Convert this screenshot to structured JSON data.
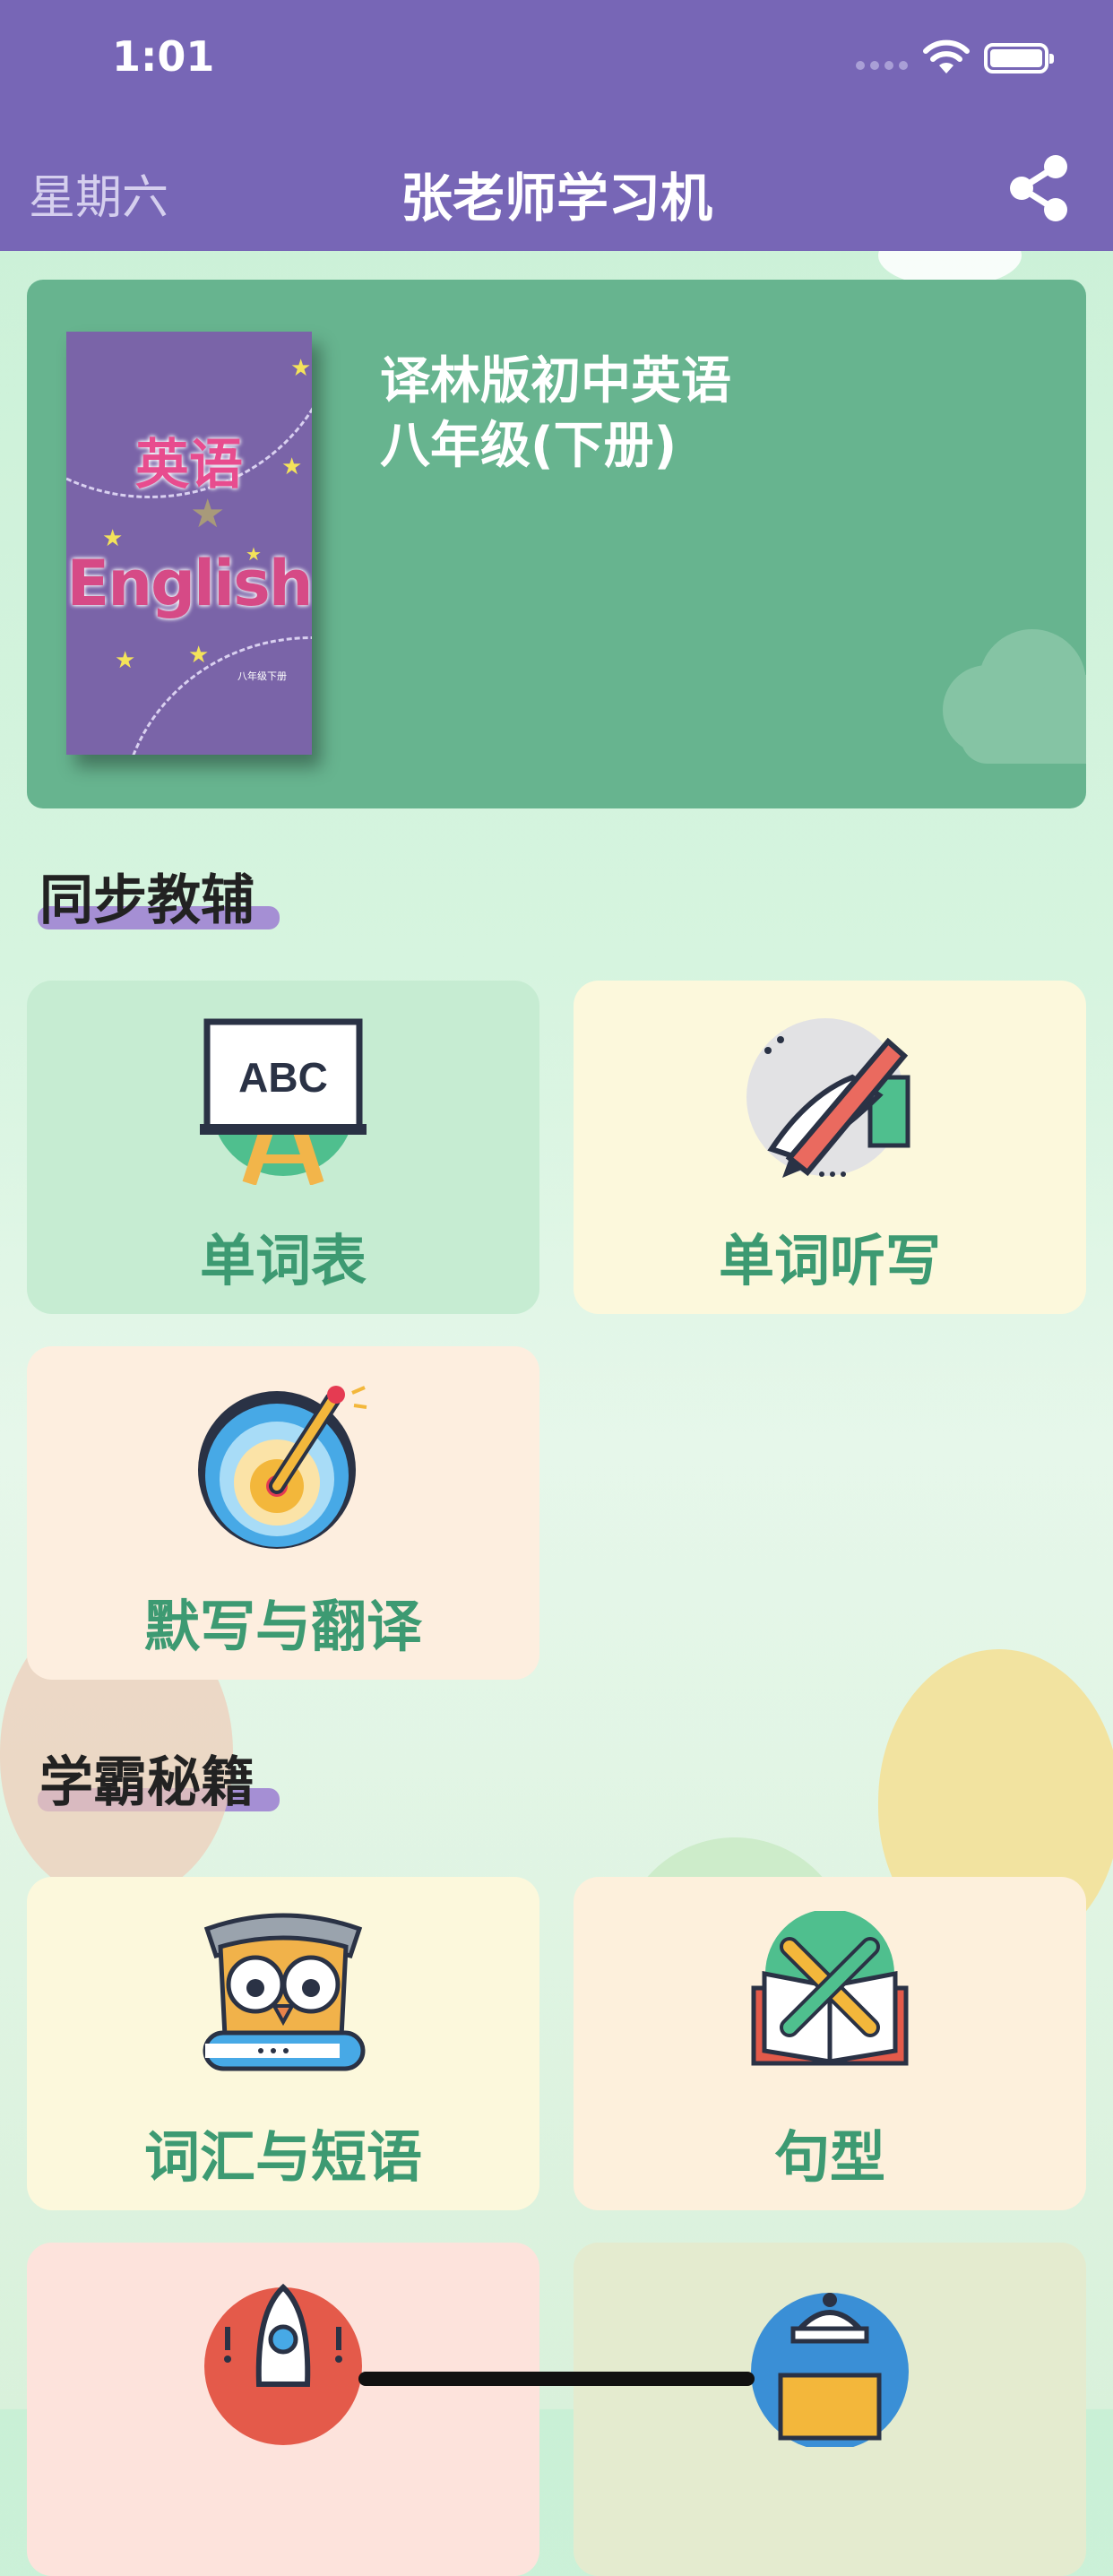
{
  "status_bar": {
    "time": "1:01"
  },
  "nav": {
    "day": "星期六",
    "title": "张老师学习机"
  },
  "book": {
    "title_line1": "译林版初中英语",
    "title_line2": "八年级(下册)",
    "cover_cn": "英语",
    "cover_en": "English",
    "cover_small": "八年级下册"
  },
  "sections": [
    {
      "title": "同步教辅"
    },
    {
      "title": "学霸秘籍"
    }
  ],
  "tiles": {
    "word_list": "单词表",
    "dictation": "单词听写",
    "translate": "默写与翻译",
    "vocab": "词汇与短语",
    "sentence": "句型"
  },
  "colors": {
    "header": "#7766b6",
    "book_card": "#67b48f",
    "tile_label": "#3d9a72",
    "tile_green": "#c6ecd2",
    "tile_yellow": "#fcf8dc",
    "tile_peach": "#fdeedf",
    "tile_pink": "#fde3dc",
    "tile_sage": "#e4ebcf"
  },
  "icons": {
    "wifi": "wifi-icon",
    "battery": "battery-icon",
    "share": "share-icon",
    "abc_board": "abc-board-icon",
    "pen_writing": "pen-writing-icon",
    "target": "target-pencil-icon",
    "owl": "owl-book-icon",
    "book_pencils": "book-pencils-icon",
    "rocket": "rocket-icon",
    "lamp": "desk-lamp-icon"
  }
}
